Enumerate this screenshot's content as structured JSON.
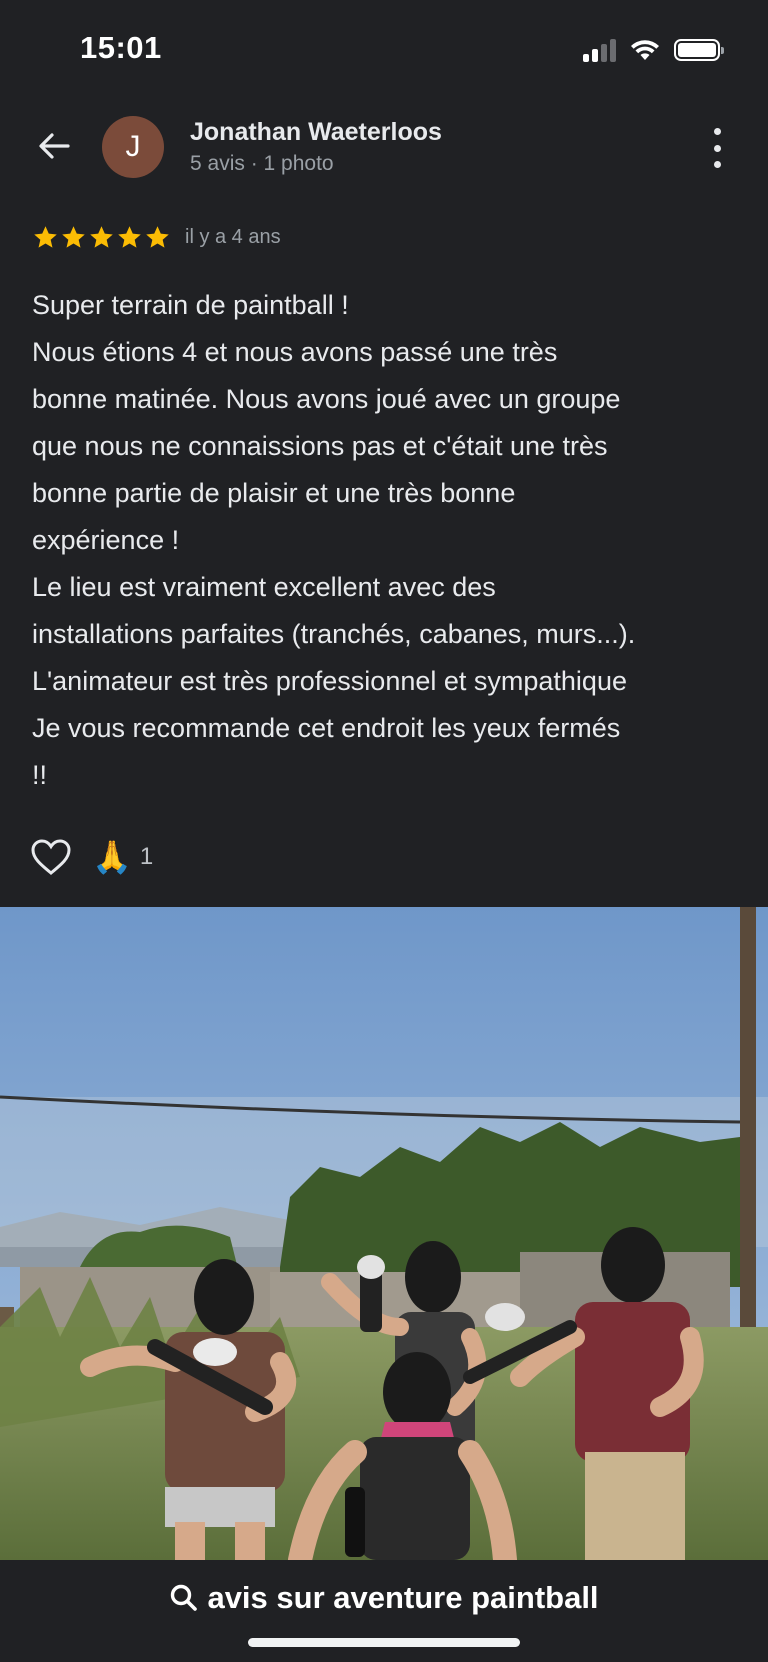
{
  "status_bar": {
    "time": "15:01"
  },
  "reviewer": {
    "initial": "J",
    "name": "Jonathan Waeterloos",
    "meta": "5 avis · 1 photo",
    "avatar_color": "#7b4b3a"
  },
  "review": {
    "stars": 5,
    "star_color": "#fbbc04",
    "date": "il y a 4 ans",
    "lines": [
      "Super terrain de paintball !",
      "Nous étions 4 et nous avons passé une très",
      "bonne matinée. Nous avons joué avec un groupe",
      "que nous ne connaissions pas et c'était une très",
      "bonne partie de plaisir et une très bonne",
      "expérience !",
      "Le lieu est vraiment excellent avec des",
      "installations parfaites (tranchés, cabanes, murs...).",
      "L'animateur est très professionnel et sympathique",
      "Je vous recommande cet endroit les yeux fermés",
      "!!"
    ]
  },
  "reactions": {
    "emoji": "🙏",
    "count": "1"
  },
  "bottom_bar": {
    "title": "avis sur aventure paintball"
  },
  "icons": {
    "back": "arrow-back-icon",
    "more": "more-vert-icon",
    "heart": "heart-outline-icon",
    "search": "search-icon"
  }
}
